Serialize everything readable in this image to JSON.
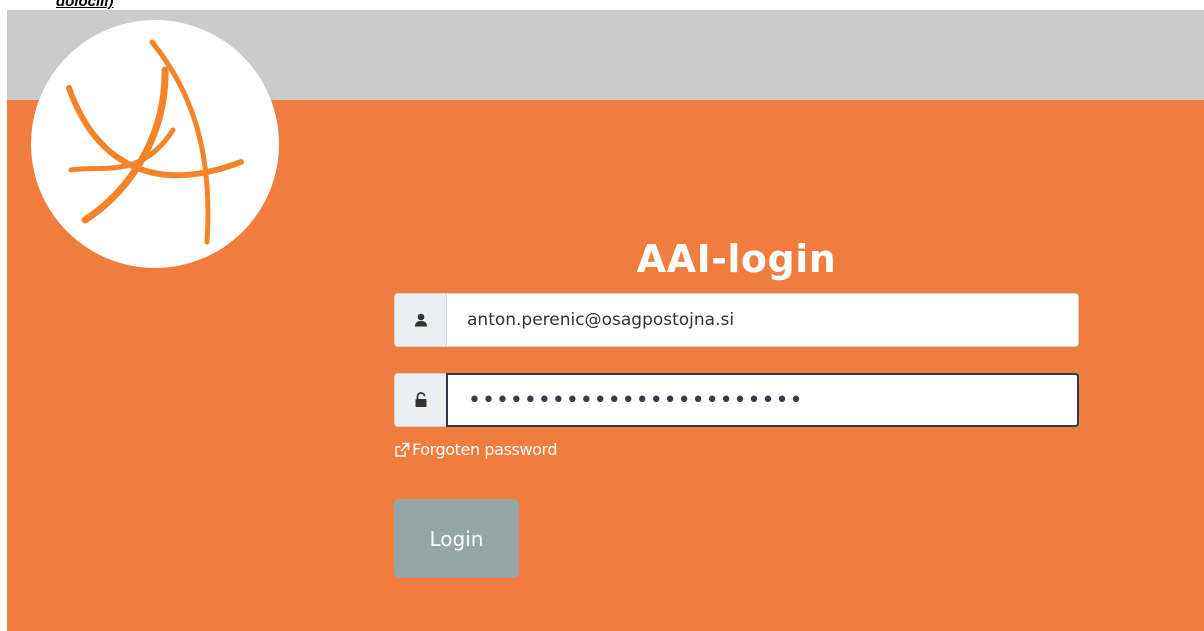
{
  "caption": "dolocili)",
  "colors": {
    "primary": "#f07d3e",
    "header_band": "#cbcbcb",
    "button": "#95a5a6",
    "logo_stroke": "#f5832a"
  },
  "logo": {
    "icon": "star-arcs-logo"
  },
  "form": {
    "title": "AAI-login",
    "username": {
      "icon": "user-icon",
      "value": "anton.perenic@osagpostojna.si"
    },
    "password": {
      "icon": "unlock-icon",
      "masked_value": "••••••••••••••••••••••••"
    },
    "forgot_link": {
      "icon": "external-link-icon",
      "label": "Forgoten password"
    },
    "login_button": "Login"
  }
}
